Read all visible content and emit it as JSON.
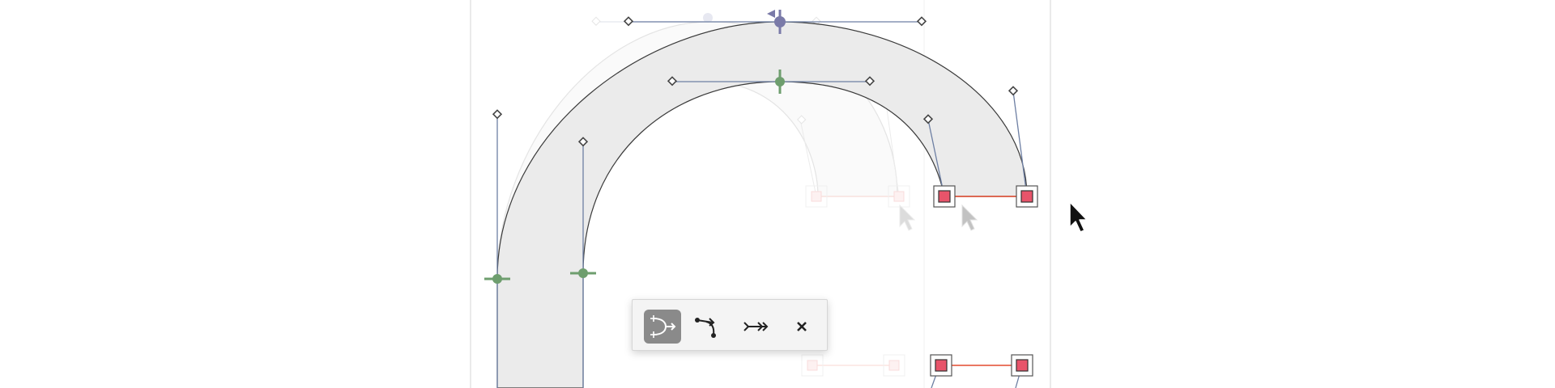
{
  "colors": {
    "canvas_border": "#e3e3e3",
    "fill": "#ebebeb",
    "outline": "#3a3a3a",
    "handle_line": "#6d7fa3",
    "smooth_node": "#6e9e6e",
    "tangent_node": "#7a7aa8",
    "corner_node": "#e8546a",
    "selection_line": "#e34a2f",
    "toolbar_bg": "#f4f4f4",
    "toolbar_active": "#8a8a8a"
  },
  "toolbar": {
    "items": [
      {
        "icon": "join-curve-icon",
        "active": true
      },
      {
        "icon": "break-node-icon",
        "active": false
      },
      {
        "icon": "arrow-forward-icon",
        "active": false
      },
      {
        "icon": "close-icon",
        "active": false
      }
    ]
  },
  "cursors": {
    "main": "arrow-cursor-icon",
    "ghosts": [
      "ghost-cursor-icon",
      "ghost-cursor-icon"
    ]
  }
}
